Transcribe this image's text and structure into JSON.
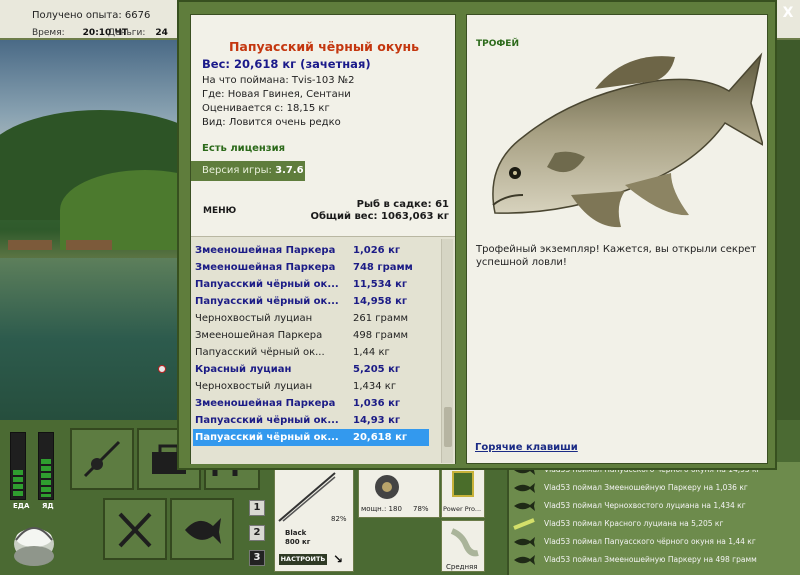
{
  "topbar": {
    "experience": "Получено опыта: 6676",
    "time_label": "Время:",
    "time_value": "20:10 ЧТ",
    "money_label": "Деньги:",
    "money_value": "24"
  },
  "gauges": {
    "left_label": "ЕДА",
    "right_label": "ЯД",
    "left_level": 0.42,
    "right_level": 0.6
  },
  "slot_numbers": [
    "1",
    "2",
    "3"
  ],
  "tackle": {
    "rod_name": "Black",
    "rod_weight": "800 кг",
    "rod_percent": "82%",
    "setup_button": "НАСТРОИТЬ",
    "reel_label": "мощн.: 180",
    "reel_percent": "78%",
    "line_label": "Power Pro...",
    "bait_label": "Средняя"
  },
  "chat": [
    "Vlad53 поймал Папуасского чёрного окуня на 14,93 кг",
    "Vlad53 поймал Змееношейную Паркеру на 1,036 кг",
    "Vlad53 поймал Чернохвостого луциана на 1,434 кг",
    "Vlad53 поймал Красного луциана на 5,205 кг",
    "Vlad53 поймал Папуасского чёрного окуня на 1,44 кг",
    "Vlad53 поймал Змееношейную Паркеру на 498 грамм"
  ],
  "dialog": {
    "close_label": "X",
    "fish_title": "Папуасский чёрный окунь",
    "fish_weight": "Вес: 20,618 кг (зачетная)",
    "info": [
      "На что поймана: Tvis-103 №2",
      "Где: Новая Гвинея, Сентани",
      "Оценивается с: 18,15 кг",
      "Вид: Ловится очень редко"
    ],
    "license": "Есть лицензия",
    "version_label": "Версия игры:",
    "version_value": "3.7.6",
    "menu": "МЕНЮ",
    "keep_count": "Рыб в садке: 61",
    "keep_weight": "Общий вес: 1063,063 кг",
    "catches": [
      {
        "name": "Змееношейная Паркера",
        "weight": "1,026 кг",
        "style": "big"
      },
      {
        "name": "Змееношейная Паркера",
        "weight": "748 грамм",
        "style": "big"
      },
      {
        "name": "Папуасский чёрный ок...",
        "weight": "11,534 кг",
        "style": "big"
      },
      {
        "name": "Папуасский чёрный ок...",
        "weight": "14,958 кг",
        "style": "big"
      },
      {
        "name": "Чернохвостый луциан",
        "weight": "261 грамм",
        "style": "normal"
      },
      {
        "name": "Змееношейная Паркера",
        "weight": "498 грамм",
        "style": "normal"
      },
      {
        "name": "Папуасский чёрный ок...",
        "weight": "1,44 кг",
        "style": "normal"
      },
      {
        "name": "Красный луциан",
        "weight": "5,205 кг",
        "style": "big"
      },
      {
        "name": "Чернохвостый луциан",
        "weight": "1,434 кг",
        "style": "normal"
      },
      {
        "name": "Змееношейная Паркера",
        "weight": "1,036 кг",
        "style": "big"
      },
      {
        "name": "Папуасский чёрный ок...",
        "weight": "14,93 кг",
        "style": "big"
      },
      {
        "name": "Папуасский чёрный ок...",
        "weight": "20,618 кг",
        "style": "selected"
      }
    ],
    "trophy_title": "ТРОФЕЙ",
    "trophy_text": "Трофейный экземпляр! Кажется, вы открыли секрет успешной ловли!",
    "hotkeys": "Горячие клавиши"
  }
}
